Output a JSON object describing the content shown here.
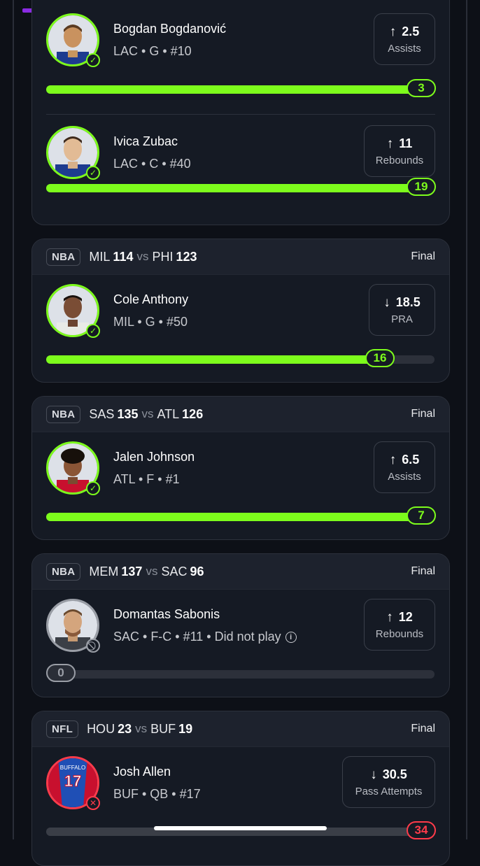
{
  "cards": [
    {
      "players": [
        {
          "name": "Bogdan Bogdanović",
          "meta": "LAC • G • #10",
          "line": "2.5",
          "direction": "over",
          "stat": "Assists",
          "actual": "3",
          "progress_percent": 100,
          "status": "hit"
        },
        {
          "name": "Ivica Zubac",
          "meta": "LAC • C • #40",
          "line": "11",
          "direction": "over",
          "stat": "Rebounds",
          "actual": "19",
          "progress_percent": 100,
          "status": "hit"
        }
      ]
    },
    {
      "league": "NBA",
      "team1": "MIL",
      "score1": "114",
      "vs": "vs",
      "team2": "PHI",
      "score2": "123",
      "status": "Final",
      "players": [
        {
          "name": "Cole Anthony",
          "meta": "MIL • G • #50",
          "line": "18.5",
          "direction": "under",
          "stat": "PRA",
          "actual": "16",
          "progress_percent": 86,
          "status": "hit"
        }
      ]
    },
    {
      "league": "NBA",
      "team1": "SAS",
      "score1": "135",
      "vs": "vs",
      "team2": "ATL",
      "score2": "126",
      "status": "Final",
      "players": [
        {
          "name": "Jalen Johnson",
          "meta": "ATL • F • #1",
          "line": "6.5",
          "direction": "over",
          "stat": "Assists",
          "actual": "7",
          "progress_percent": 100,
          "status": "hit"
        }
      ]
    },
    {
      "league": "NBA",
      "team1": "MEM",
      "score1": "137",
      "vs": "vs",
      "team2": "SAC",
      "score2": "96",
      "status": "Final",
      "players": [
        {
          "name": "Domantas Sabonis",
          "meta": "SAC • F-C • #11 • Did not play",
          "line": "12",
          "direction": "over",
          "stat": "Rebounds",
          "actual": "0",
          "progress_percent": 0,
          "status": "dnp"
        }
      ]
    },
    {
      "league": "NFL",
      "team1": "HOU",
      "score1": "23",
      "vs": "vs",
      "team2": "BUF",
      "score2": "19",
      "status": "Final",
      "players": [
        {
          "name": "Josh Allen",
          "meta": "BUF • QB • #17",
          "line": "30.5",
          "direction": "under",
          "stat": "Pass Attempts",
          "actual": "34",
          "progress_percent": 100,
          "status": "miss",
          "jersey": "BUFFALO",
          "jersey_number": "17"
        }
      ]
    }
  ],
  "icons": {
    "over": "arrow-up-icon",
    "under": "arrow-down-icon",
    "hit": "check-icon",
    "dnp": "slash-icon",
    "miss": "x-icon",
    "info": "info-icon"
  },
  "colors": {
    "accent": "#7dfc1c",
    "miss": "#ff3b4a",
    "neutral": "#9a9ea6",
    "top_progress": "#8a2be2"
  }
}
